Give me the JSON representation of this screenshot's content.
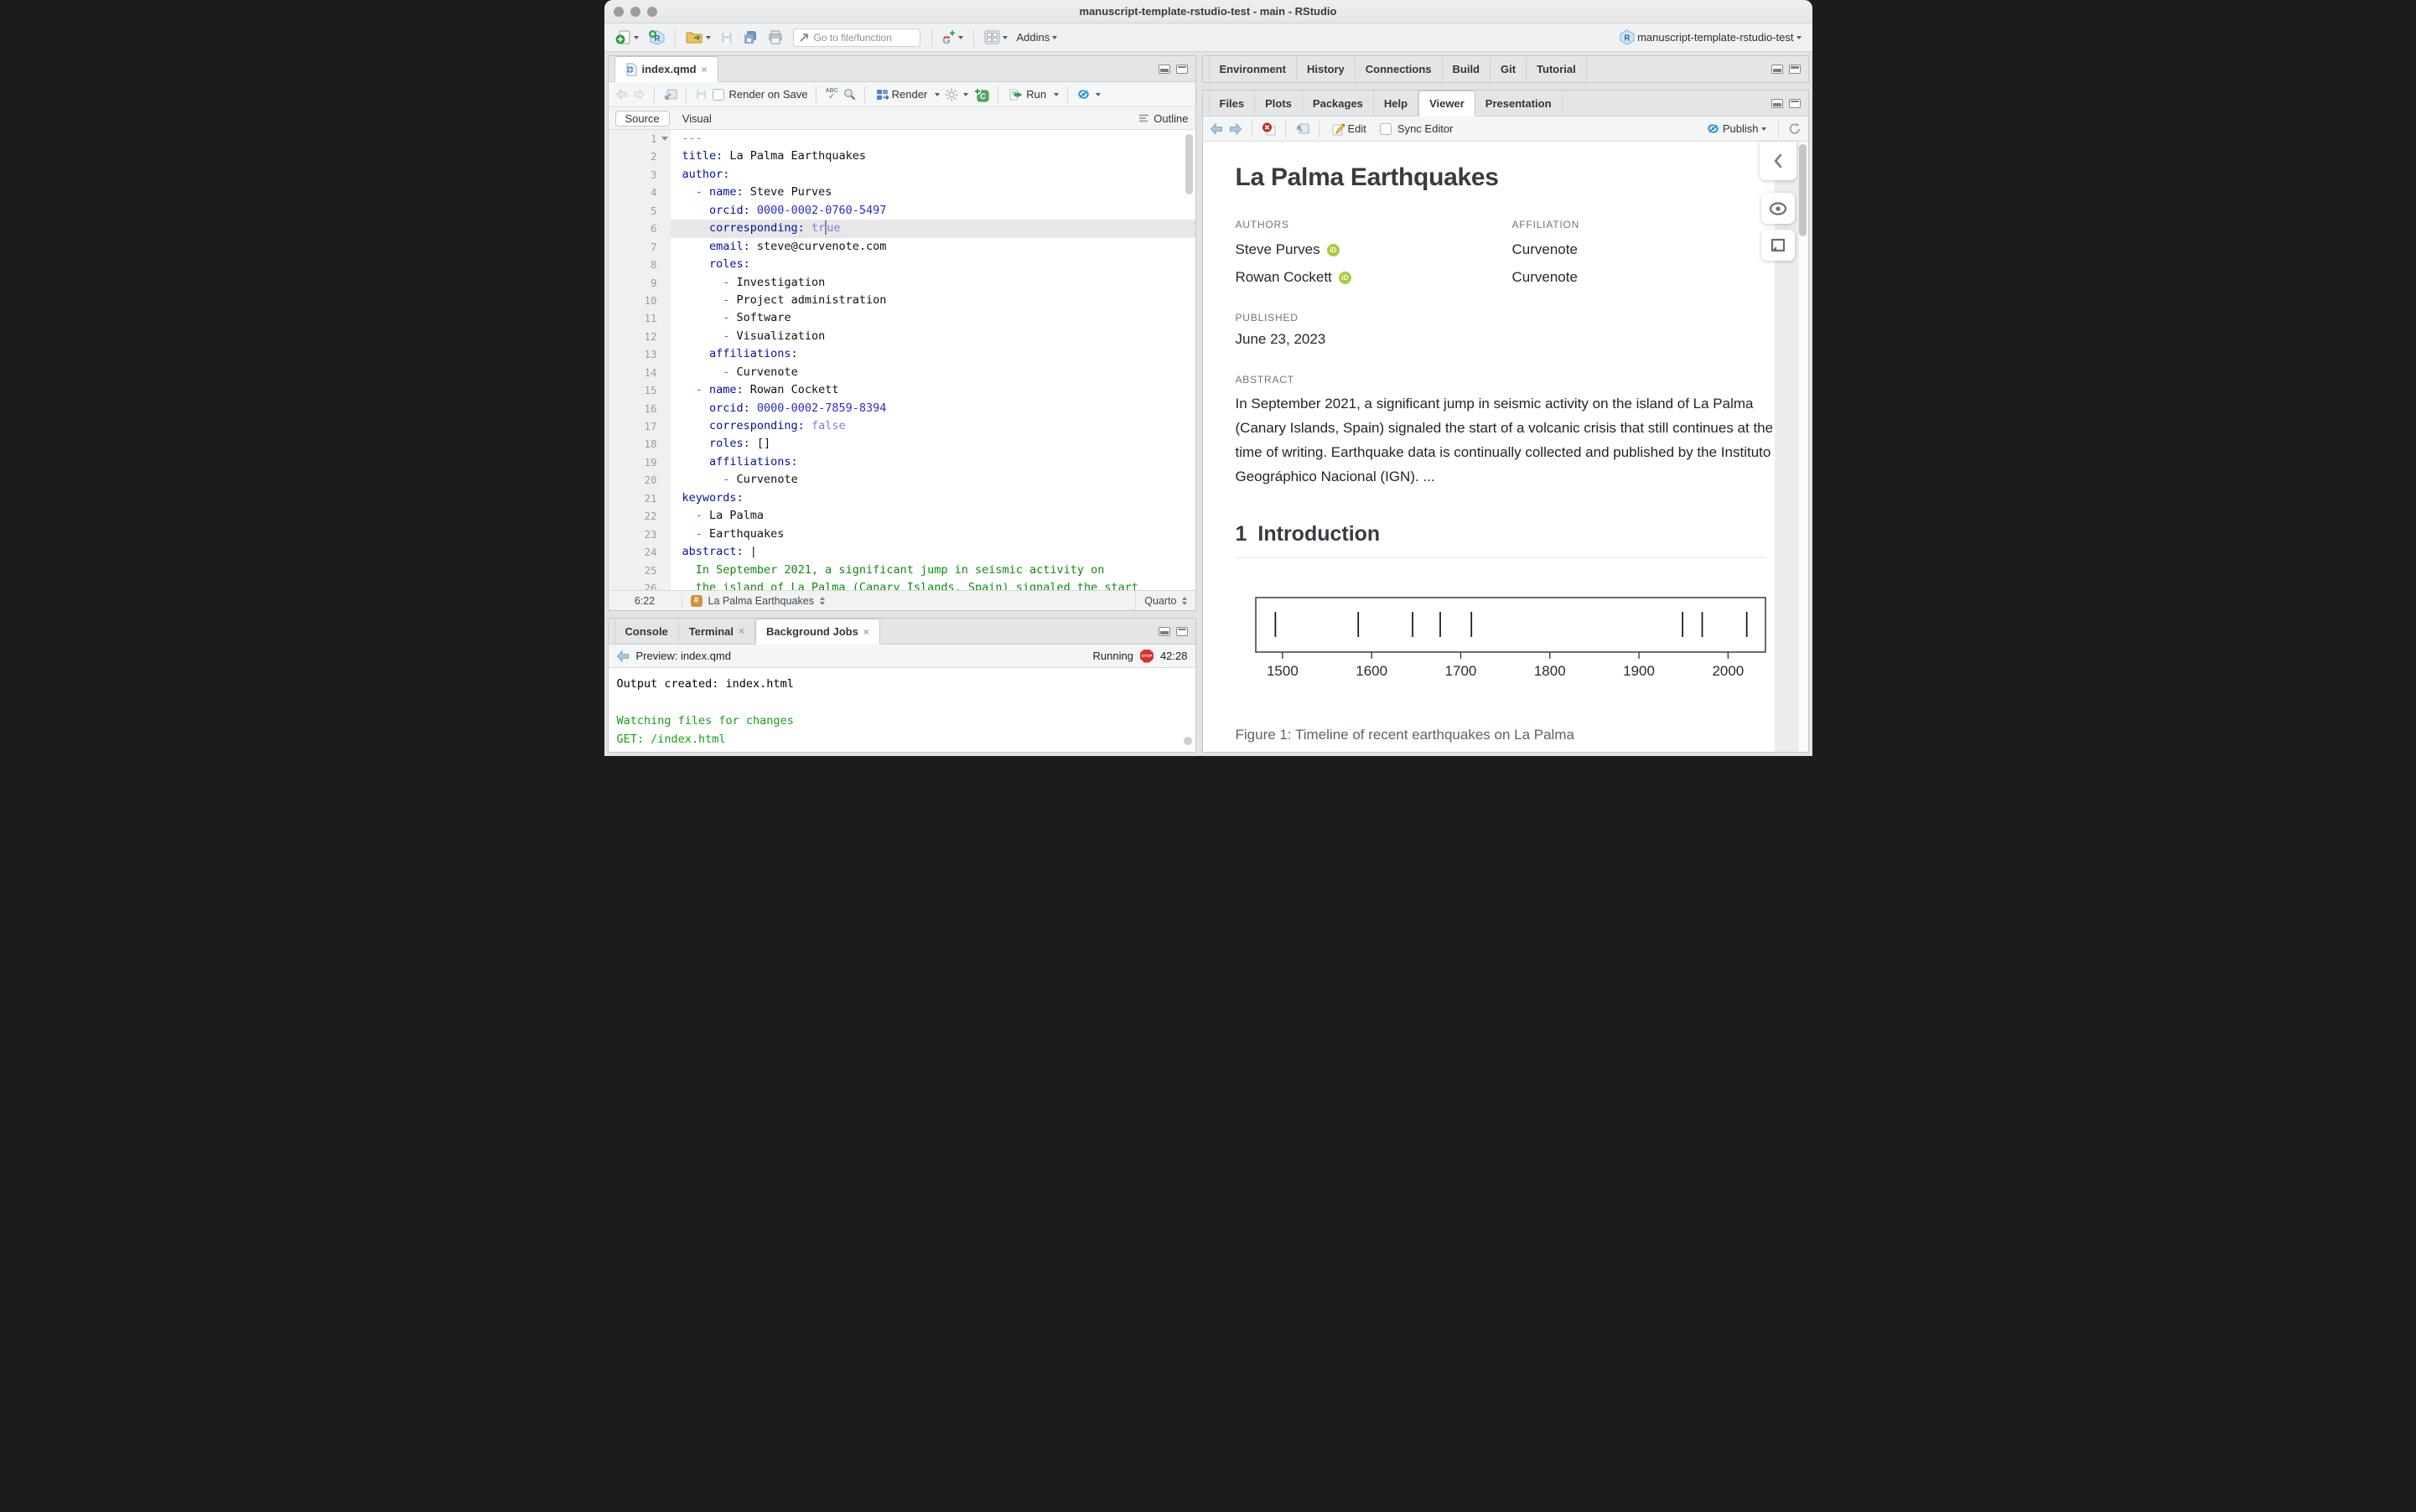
{
  "window": {
    "title": "manuscript-template-rstudio-test - main - RStudio"
  },
  "main_toolbar": {
    "goto_placeholder": "Go to file/function",
    "addins_label": "Addins",
    "project_name": "manuscript-template-rstudio-test"
  },
  "source_pane": {
    "tab": {
      "filename": "index.qmd"
    },
    "toolbar": {
      "render_on_save": "Render on Save",
      "render": "Render",
      "run": "Run"
    },
    "mode_tabs": {
      "source": "Source",
      "visual": "Visual",
      "outline": "Outline"
    },
    "status": {
      "position": "6:22",
      "outline_item": "La Palma Earthquakes",
      "format": "Quarto"
    },
    "code_lines": [
      {
        "n": 1,
        "fold": true,
        "seg": [
          [
            "m",
            "---"
          ]
        ]
      },
      {
        "n": 2,
        "seg": [
          [
            "k",
            "title:"
          ],
          [
            "p",
            " La Palma Earthquakes"
          ]
        ]
      },
      {
        "n": 3,
        "seg": [
          [
            "k",
            "author:"
          ]
        ]
      },
      {
        "n": 4,
        "seg": [
          [
            "p",
            "  "
          ],
          [
            "d",
            "- "
          ],
          [
            "k",
            "name:"
          ],
          [
            "p",
            " Steve Purves"
          ]
        ]
      },
      {
        "n": 5,
        "seg": [
          [
            "p",
            "    "
          ],
          [
            "k",
            "orcid:"
          ],
          [
            "v",
            " 0000-0002-0760-5497"
          ]
        ]
      },
      {
        "n": 6,
        "hl": true,
        "seg": [
          [
            "p",
            "    "
          ],
          [
            "k",
            "corresponding:"
          ],
          [
            "b",
            " tr"
          ],
          [
            "c",
            ""
          ],
          [
            "b",
            "ue"
          ]
        ]
      },
      {
        "n": 7,
        "seg": [
          [
            "p",
            "    "
          ],
          [
            "k",
            "email:"
          ],
          [
            "p",
            " steve@curvenote.com"
          ]
        ]
      },
      {
        "n": 8,
        "seg": [
          [
            "p",
            "    "
          ],
          [
            "k",
            "roles:"
          ]
        ]
      },
      {
        "n": 9,
        "seg": [
          [
            "p",
            "      "
          ],
          [
            "d",
            "- "
          ],
          [
            "p",
            "Investigation"
          ]
        ]
      },
      {
        "n": 10,
        "seg": [
          [
            "p",
            "      "
          ],
          [
            "d",
            "- "
          ],
          [
            "p",
            "Project administration"
          ]
        ]
      },
      {
        "n": 11,
        "seg": [
          [
            "p",
            "      "
          ],
          [
            "d",
            "- "
          ],
          [
            "p",
            "Software"
          ]
        ]
      },
      {
        "n": 12,
        "seg": [
          [
            "p",
            "      "
          ],
          [
            "d",
            "- "
          ],
          [
            "p",
            "Visualization"
          ]
        ]
      },
      {
        "n": 13,
        "seg": [
          [
            "p",
            "    "
          ],
          [
            "k",
            "affiliations:"
          ]
        ]
      },
      {
        "n": 14,
        "seg": [
          [
            "p",
            "      "
          ],
          [
            "d",
            "- "
          ],
          [
            "p",
            "Curvenote"
          ]
        ]
      },
      {
        "n": 15,
        "seg": [
          [
            "p",
            "  "
          ],
          [
            "d",
            "- "
          ],
          [
            "k",
            "name:"
          ],
          [
            "p",
            " Rowan Cockett"
          ]
        ]
      },
      {
        "n": 16,
        "seg": [
          [
            "p",
            "    "
          ],
          [
            "k",
            "orcid:"
          ],
          [
            "v",
            " 0000-0002-7859-8394"
          ]
        ]
      },
      {
        "n": 17,
        "seg": [
          [
            "p",
            "    "
          ],
          [
            "k",
            "corresponding:"
          ],
          [
            "b",
            " false"
          ]
        ]
      },
      {
        "n": 18,
        "seg": [
          [
            "p",
            "    "
          ],
          [
            "k",
            "roles:"
          ],
          [
            "p",
            " []"
          ]
        ]
      },
      {
        "n": 19,
        "seg": [
          [
            "p",
            "    "
          ],
          [
            "k",
            "affiliations:"
          ]
        ]
      },
      {
        "n": 20,
        "seg": [
          [
            "p",
            "      "
          ],
          [
            "d",
            "- "
          ],
          [
            "p",
            "Curvenote"
          ]
        ]
      },
      {
        "n": 21,
        "seg": [
          [
            "k",
            "keywords:"
          ]
        ]
      },
      {
        "n": 22,
        "seg": [
          [
            "p",
            "  "
          ],
          [
            "d",
            "- "
          ],
          [
            "p",
            "La Palma"
          ]
        ]
      },
      {
        "n": 23,
        "seg": [
          [
            "p",
            "  "
          ],
          [
            "d",
            "- "
          ],
          [
            "p",
            "Earthquakes"
          ]
        ]
      },
      {
        "n": 24,
        "seg": [
          [
            "k",
            "abstract:"
          ],
          [
            "p",
            " |"
          ]
        ]
      },
      {
        "n": 25,
        "seg": [
          [
            "s",
            "  In September 2021, a significant jump in seismic activity on"
          ]
        ]
      },
      {
        "n": 26,
        "seg": [
          [
            "s",
            "  the island of La Palma (Canary Islands, Spain) signaled the start"
          ]
        ]
      }
    ]
  },
  "console_pane": {
    "tabs": [
      {
        "label": "Console",
        "closable": false,
        "active": false
      },
      {
        "label": "Terminal",
        "closable": true,
        "active": false
      },
      {
        "label": "Background Jobs",
        "closable": true,
        "active": true
      }
    ],
    "toolbar": {
      "preview": "Preview: index.qmd",
      "status": "Running",
      "stop_label": "STOP",
      "elapsed": "42:28"
    },
    "output": [
      {
        "cls": "plain",
        "text": "Output created: index.html"
      },
      {
        "cls": "plain",
        "text": ""
      },
      {
        "cls": "green",
        "text": "Watching files for changes"
      },
      {
        "cls": "green",
        "text": "GET: /index.html"
      }
    ]
  },
  "right_top_tabs": [
    "Environment",
    "History",
    "Connections",
    "Build",
    "Git",
    "Tutorial"
  ],
  "viewer_pane": {
    "tabs": [
      {
        "label": "Files",
        "active": false
      },
      {
        "label": "Plots",
        "active": false
      },
      {
        "label": "Packages",
        "active": false
      },
      {
        "label": "Help",
        "active": false
      },
      {
        "label": "Viewer",
        "active": true
      },
      {
        "label": "Presentation",
        "active": false
      }
    ],
    "toolbar": {
      "edit": "Edit",
      "sync_editor": "Sync Editor",
      "publish": "Publish"
    },
    "document": {
      "title": "La Palma Earthquakes",
      "authors_label": "AUTHORS",
      "affiliation_label": "AFFILIATION",
      "authors": [
        {
          "name": "Steve Purves",
          "orcid_icon": "iD",
          "affiliation": "Curvenote"
        },
        {
          "name": "Rowan Cockett",
          "orcid_icon": "iD",
          "affiliation": "Curvenote"
        }
      ],
      "published_label": "PUBLISHED",
      "published_date": "June 23, 2023",
      "abstract_label": "ABSTRACT",
      "abstract_text": "In September 2021, a significant jump in seismic activity on the island of La Palma (Canary Islands, Spain) signaled the start of a volcanic crisis that still continues at the time of writing. Earthquake data is continually collected and published by the Instituto Geográphico Nacional (IGN). ...",
      "section_number": "1",
      "section_title": "Introduction",
      "figure_caption": "Figure 1: Timeline of recent earthquakes on La Palma"
    }
  },
  "chart_data": {
    "type": "rug",
    "title": "Timeline of recent earthquakes on La Palma",
    "x": [
      1492,
      1585,
      1646,
      1677,
      1712,
      1949,
      1971,
      2021
    ],
    "xlabel": "",
    "ylabel": "",
    "xticks": [
      1500,
      1600,
      1700,
      1800,
      1900,
      2000
    ],
    "xlim": [
      1470,
      2042
    ],
    "grid": false,
    "caption": "Figure 1: Timeline of recent earthquakes on La Palma"
  },
  "colors": {
    "orcid_green": "#A6CE39",
    "console_green": "#14A014",
    "stop_red": "#D8352A",
    "publish_blue": "#2792D8",
    "syntax_key_blue": "#050FA0",
    "syntax_value_blue": "#2B2BD5",
    "syntax_bool": "#7D7DE8",
    "syntax_dash_magenta": "#C52E8D",
    "syntax_string_green": "#0D8B0D"
  }
}
